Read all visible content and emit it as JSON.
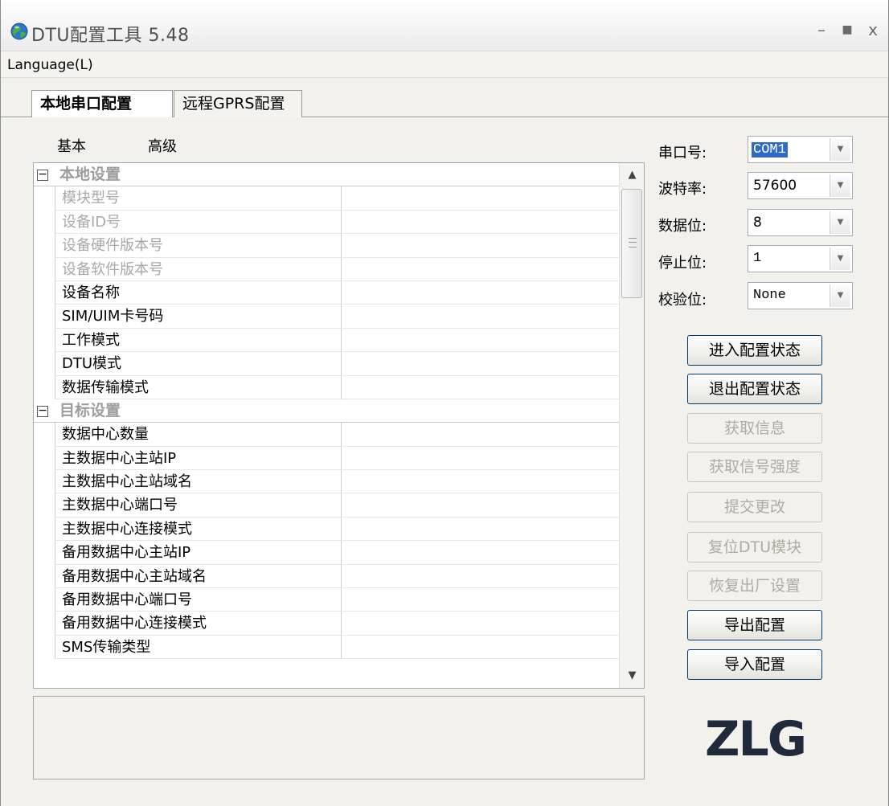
{
  "window": {
    "title": "DTU配置工具 5.48",
    "minimize": "–",
    "maximize": "■",
    "close": "x"
  },
  "menubar": {
    "language": "Language(L)"
  },
  "tabs": [
    {
      "label": "本地串口配置",
      "active": true
    },
    {
      "label": "远程GPRS配置",
      "active": false
    }
  ],
  "subtabs": [
    "基本",
    "高级"
  ],
  "property_grid": {
    "categories": [
      {
        "label": "本地设置",
        "items": [
          {
            "label": "模块型号",
            "disabled": true
          },
          {
            "label": "设备ID号",
            "disabled": true
          },
          {
            "label": "设备硬件版本号",
            "disabled": true
          },
          {
            "label": "设备软件版本号",
            "disabled": true
          },
          {
            "label": "设备名称",
            "disabled": false
          },
          {
            "label": "SIM/UIM卡号码",
            "disabled": false
          },
          {
            "label": "工作模式",
            "disabled": false
          },
          {
            "label": "DTU模式",
            "disabled": false
          },
          {
            "label": "数据传输模式",
            "disabled": false
          }
        ]
      },
      {
        "label": "目标设置",
        "items": [
          {
            "label": "数据中心数量",
            "disabled": false
          },
          {
            "label": "主数据中心主站IP",
            "disabled": false
          },
          {
            "label": "主数据中心主站域名",
            "disabled": false
          },
          {
            "label": "主数据中心端口号",
            "disabled": false
          },
          {
            "label": "主数据中心连接模式",
            "disabled": false
          },
          {
            "label": "备用数据中心主站IP",
            "disabled": false
          },
          {
            "label": "备用数据中心主站域名",
            "disabled": false
          },
          {
            "label": "备用数据中心端口号",
            "disabled": false
          },
          {
            "label": "备用数据中心连接模式",
            "disabled": false
          },
          {
            "label": "SMS传输类型",
            "disabled": false
          }
        ]
      }
    ]
  },
  "serial": {
    "port": {
      "label": "串口号:",
      "value": "COM1"
    },
    "baud": {
      "label": "波特率:",
      "value": "57600"
    },
    "databits": {
      "label": "数据位:",
      "value": "8"
    },
    "stopbits": {
      "label": "停止位:",
      "value": "1"
    },
    "parity": {
      "label": "校验位:",
      "value": "None"
    }
  },
  "buttons": [
    {
      "label": "进入配置状态",
      "enabled": true
    },
    {
      "label": "退出配置状态",
      "enabled": true
    },
    {
      "label": "获取信息",
      "enabled": false
    },
    {
      "label": "获取信号强度",
      "enabled": false
    },
    {
      "label": "提交更改",
      "enabled": false
    },
    {
      "label": "复位DTU模块",
      "enabled": false
    },
    {
      "label": "恢复出厂设置",
      "enabled": false
    },
    {
      "label": "导出配置",
      "enabled": true
    },
    {
      "label": "导入配置",
      "enabled": true
    }
  ],
  "logo": {
    "text": "ZLG"
  },
  "colors": {
    "accent": "#316ac5",
    "button_border": "#003c74",
    "disabled_text": "#a8a8a8"
  }
}
